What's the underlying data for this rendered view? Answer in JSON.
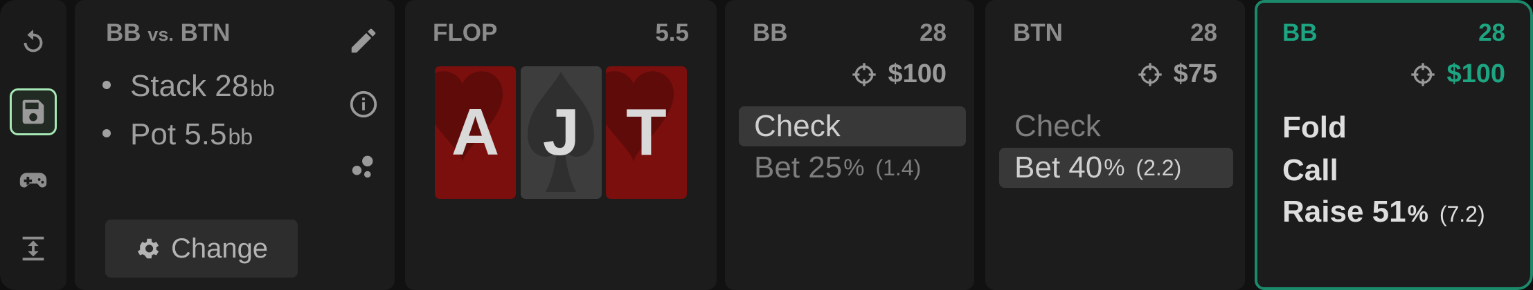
{
  "toolbar": {
    "icons": [
      "reset-icon",
      "save-icon",
      "gamepad-icon",
      "expand-vertical-icon"
    ],
    "active": "save-icon"
  },
  "info": {
    "title_left": "BB",
    "title_vs": "vs.",
    "title_right": "BTN",
    "stack_label": "Stack 28",
    "stack_unit": "bb",
    "pot_label": "Pot 5.5",
    "pot_unit": "bb",
    "change_label": "Change",
    "side_icons": [
      "pencil-icon",
      "info-icon",
      "cluster-icon"
    ]
  },
  "flop": {
    "label": "FLOP",
    "pot": "5.5",
    "cards": [
      {
        "rank": "A",
        "suit": "heart"
      },
      {
        "rank": "J",
        "suit": "spade"
      },
      {
        "rank": "T",
        "suit": "heart"
      }
    ]
  },
  "panel_bb": {
    "player": "BB",
    "stack": "28",
    "money": "$100",
    "actions": [
      {
        "label": "Check",
        "pct": "",
        "amount": "",
        "selected": true
      },
      {
        "label": "Bet 25",
        "pct": "%",
        "amount": "(1.4)",
        "selected": false
      }
    ]
  },
  "panel_btn": {
    "player": "BTN",
    "stack": "28",
    "money": "$75",
    "actions": [
      {
        "label": "Check",
        "pct": "",
        "amount": "",
        "selected": false
      },
      {
        "label": "Bet 40",
        "pct": "%",
        "amount": "(2.2)",
        "selected": true
      }
    ]
  },
  "panel_bb2": {
    "player": "BB",
    "stack": "28",
    "money": "$100",
    "actions": [
      {
        "label": "Fold",
        "pct": "",
        "amount": ""
      },
      {
        "label": "Call",
        "pct": "",
        "amount": ""
      },
      {
        "label": "Raise 51",
        "pct": "%",
        "amount": "(7.2)"
      }
    ]
  },
  "colors": {
    "accent_teal": "#1da582",
    "save_highlight": "#a6e8b6",
    "heart_card": "#7a0f0d",
    "spade_card": "#3d3d3d"
  }
}
